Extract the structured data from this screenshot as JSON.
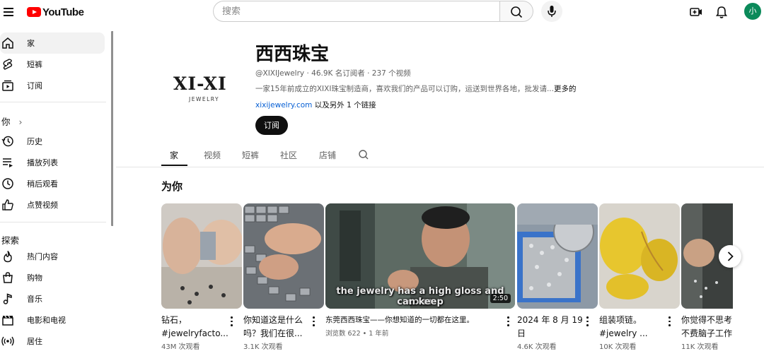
{
  "header": {
    "logo_text": "YouTube",
    "search_placeholder": "搜索",
    "avatar_letter": "小",
    "colors": {
      "brand_red": "#ff0000",
      "avatar_bg": "#0b8a5a",
      "link_blue": "#065fd4"
    }
  },
  "sidebar": {
    "items_top": [
      {
        "label": "家",
        "icon": "home-icon",
        "active": true
      },
      {
        "label": "短裤",
        "icon": "shorts-icon"
      },
      {
        "label": "订阅",
        "icon": "subscriptions-icon"
      }
    ],
    "you_heading": "你",
    "you_chevron": "›",
    "items_you": [
      {
        "label": "历史",
        "icon": "history-icon"
      },
      {
        "label": "播放列表",
        "icon": "playlist-icon"
      },
      {
        "label": "稍后观看",
        "icon": "watch-later-icon"
      },
      {
        "label": "点赞视频",
        "icon": "like-icon"
      }
    ],
    "explore_heading": "探索",
    "items_explore": [
      {
        "label": "热门内容",
        "icon": "trending-icon"
      },
      {
        "label": "购物",
        "icon": "shopping-icon"
      },
      {
        "label": "音乐",
        "icon": "music-icon"
      },
      {
        "label": "电影和电视",
        "icon": "movies-icon"
      },
      {
        "label": "居住",
        "icon": "live-icon"
      }
    ]
  },
  "channel": {
    "logo_wordmark": "XI-XI",
    "logo_subtext": "JEWELRY",
    "name": "西西珠宝",
    "handle": "@XIXIJewelry",
    "subscribers": "46.9K 名订阅者",
    "video_count": "237 个视频",
    "meta_separator": " · ",
    "description": "一家15年前成立的XIXI珠宝制造商，喜欢我们的产品可以订购，运送到世界各地，批发请...",
    "more_label": "更多的",
    "link_url": "xixijewelry.com",
    "link_suffix": " 以及另外 1 个链接",
    "subscribe_label": "订阅"
  },
  "tabs": [
    "家",
    "视频",
    "短裤",
    "社区",
    "店铺"
  ],
  "active_tab": 0,
  "section_title": "为你",
  "videos": [
    {
      "title_line1": "钻石，",
      "title_line2": "#jewelryfacto...",
      "meta": "43M 次观看"
    },
    {
      "title_line1": "你知道这是什么",
      "title_line2": "吗？我们在很...",
      "meta": "3.1K 次观看"
    },
    {
      "title_line1": "东莞西西珠宝——你想知道的一切都在这里。",
      "meta": "浏览数 622 • 1 年前",
      "duration": "2:50",
      "caption_line1": "the jewelry has a high gloss and color",
      "caption_line2": "can keep"
    },
    {
      "title_line1": "2024 年 8 月 19",
      "title_line2": "日",
      "meta": "4.6K 次观看"
    },
    {
      "title_line1": "组装项链。",
      "title_line2": "#jewelry ...",
      "meta": "10K 次观看"
    },
    {
      "title_line1": "你觉得不思考",
      "title_line2": "不费脑子工作",
      "meta": "11K 次观看"
    }
  ]
}
